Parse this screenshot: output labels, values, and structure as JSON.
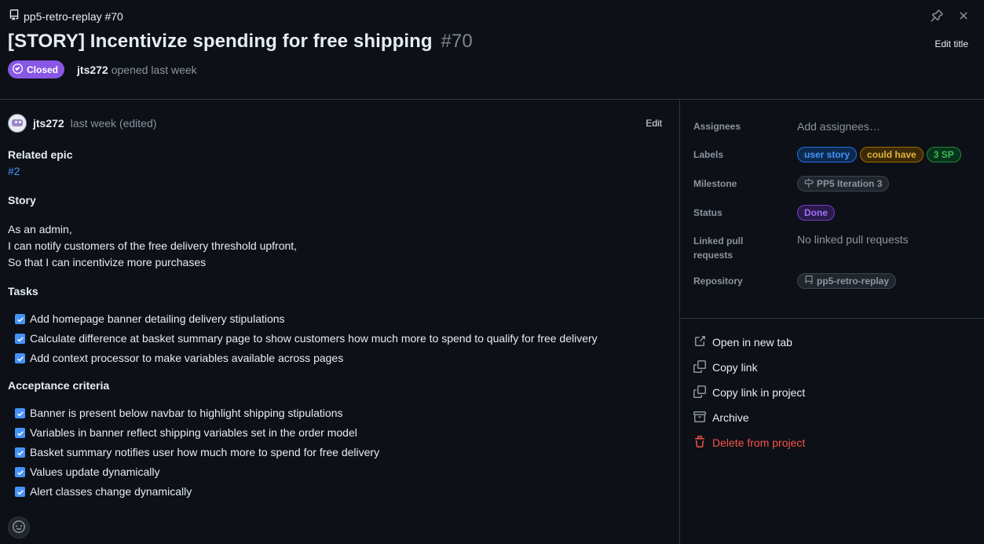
{
  "header": {
    "repo_ref": "pp5-retro-replay #70",
    "title": "[STORY] Incentivize spending for free shipping",
    "issue_number": "#70",
    "edit_title_label": "Edit title",
    "state_badge": "Closed",
    "author": "jts272",
    "opened_text": "opened last week",
    "icons": [
      "repo-icon",
      "pin-icon",
      "close-icon",
      "check-circle-icon"
    ]
  },
  "comment": {
    "author": "jts272",
    "time": "last week (edited)",
    "edit_label": "Edit",
    "related_epic_heading": "Related epic",
    "related_epic_link": "#2",
    "story_heading": "Story",
    "story_lines": [
      "As an admin,",
      "I can notify customers of the free delivery threshold upfront,",
      "So that I can incentivize more purchases"
    ],
    "tasks_heading": "Tasks",
    "tasks": [
      "Add homepage banner detailing delivery stipulations",
      "Calculate difference at basket summary page to show customers how much more to spend to qualify for free delivery",
      "Add context processor to make variables available across pages"
    ],
    "acceptance_heading": "Acceptance criteria",
    "acceptance": [
      "Banner is present below navbar to highlight shipping stipulations",
      "Variables in banner reflect shipping variables set in the order model",
      "Basket summary notifies user how much more to spend for free delivery",
      "Values update dynamically",
      "Alert classes change dynamically"
    ]
  },
  "sidebar": {
    "assignees_label": "Assignees",
    "assignees_value": "Add assignees…",
    "labels_label": "Labels",
    "labels": [
      {
        "text": "user story",
        "color": "#4493f8",
        "bg": "#0d2a4e",
        "border": "#1f6feb"
      },
      {
        "text": "could have",
        "color": "#e3b341",
        "bg": "#3b2a05",
        "border": "#9e6a03"
      },
      {
        "text": "3 SP",
        "color": "#3fb950",
        "bg": "#06351c",
        "border": "#238636"
      }
    ],
    "milestone_label": "Milestone",
    "milestone_value": "PP5 Iteration 3",
    "status_label": "Status",
    "status_value": "Done",
    "status_color": "#a371f7",
    "linked_pr_label": "Linked pull requests",
    "linked_pr_value": "No linked pull requests",
    "repository_label": "Repository",
    "repository_value": "pp5-retro-replay",
    "actions": [
      {
        "label": "Open in new tab",
        "icon": "link-external-icon"
      },
      {
        "label": "Copy link",
        "icon": "copy-icon"
      },
      {
        "label": "Copy link in project",
        "icon": "copy-icon"
      },
      {
        "label": "Archive",
        "icon": "archive-icon"
      },
      {
        "label": "Delete from project",
        "icon": "trash-icon"
      }
    ]
  }
}
